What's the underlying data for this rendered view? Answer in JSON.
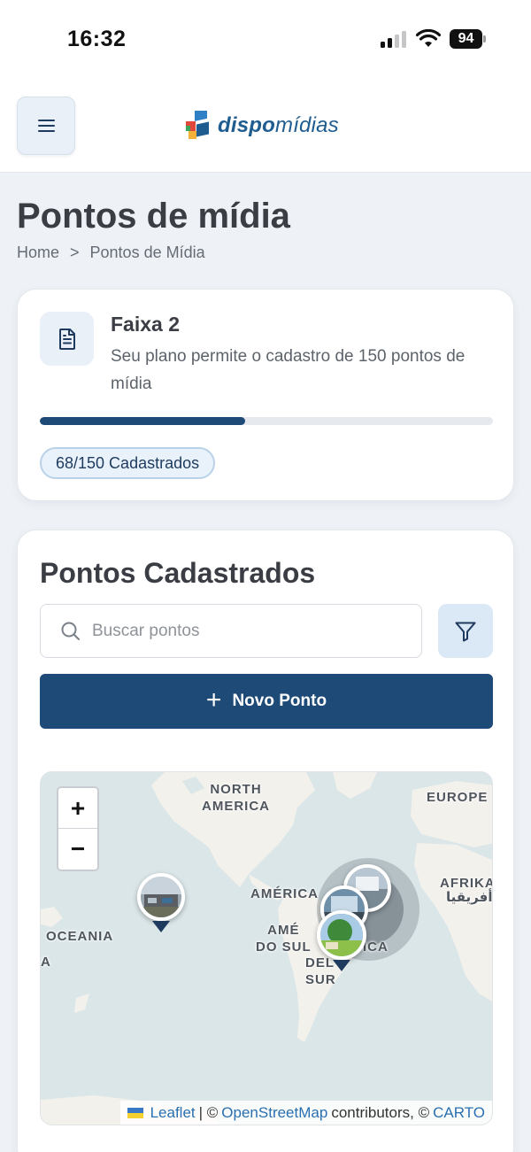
{
  "status_bar": {
    "time": "16:32",
    "battery": "94"
  },
  "header": {
    "logo_bold": "dispo",
    "logo_rest": "mídias"
  },
  "page": {
    "title": "Pontos de mídia",
    "breadcrumb": {
      "home": "Home",
      "separator": ">",
      "current": "Pontos de Mídia"
    }
  },
  "plan": {
    "name": "Faixa 2",
    "description": "Seu plano permite o cadastro de 150 pontos de mídia",
    "used": 68,
    "limit": 150,
    "progress_fraction": 0.453,
    "count_label": "68/150 Cadastrados"
  },
  "points": {
    "section_title": "Pontos Cadastrados",
    "search_placeholder": "Buscar pontos",
    "new_button_label": "Novo Ponto"
  },
  "map": {
    "labels": {
      "north_america": "NORTH\nAMERICA",
      "europe": "EUROPE",
      "america": "AMÉRICA",
      "afrika": "AFRIKA",
      "afrika_arabic": "أفريقيا",
      "oceania": "OCEANIA",
      "oceania_cut": "A",
      "south_america": "AMÉ\nDO SUL",
      "south_america_2": "ICA",
      "south_america_3": "DEL\nSUR"
    },
    "zoom_in": "+",
    "zoom_out": "−",
    "attribution": {
      "leaflet": "Leaflet",
      "sep": "| ©",
      "osm": "OpenStreetMap",
      "contributors": "contributors, ©",
      "carto": "CARTO"
    }
  },
  "colors": {
    "primary": "#1e4a78",
    "accent_bg": "#e9f0f8",
    "page_bg": "#eef2f6"
  }
}
